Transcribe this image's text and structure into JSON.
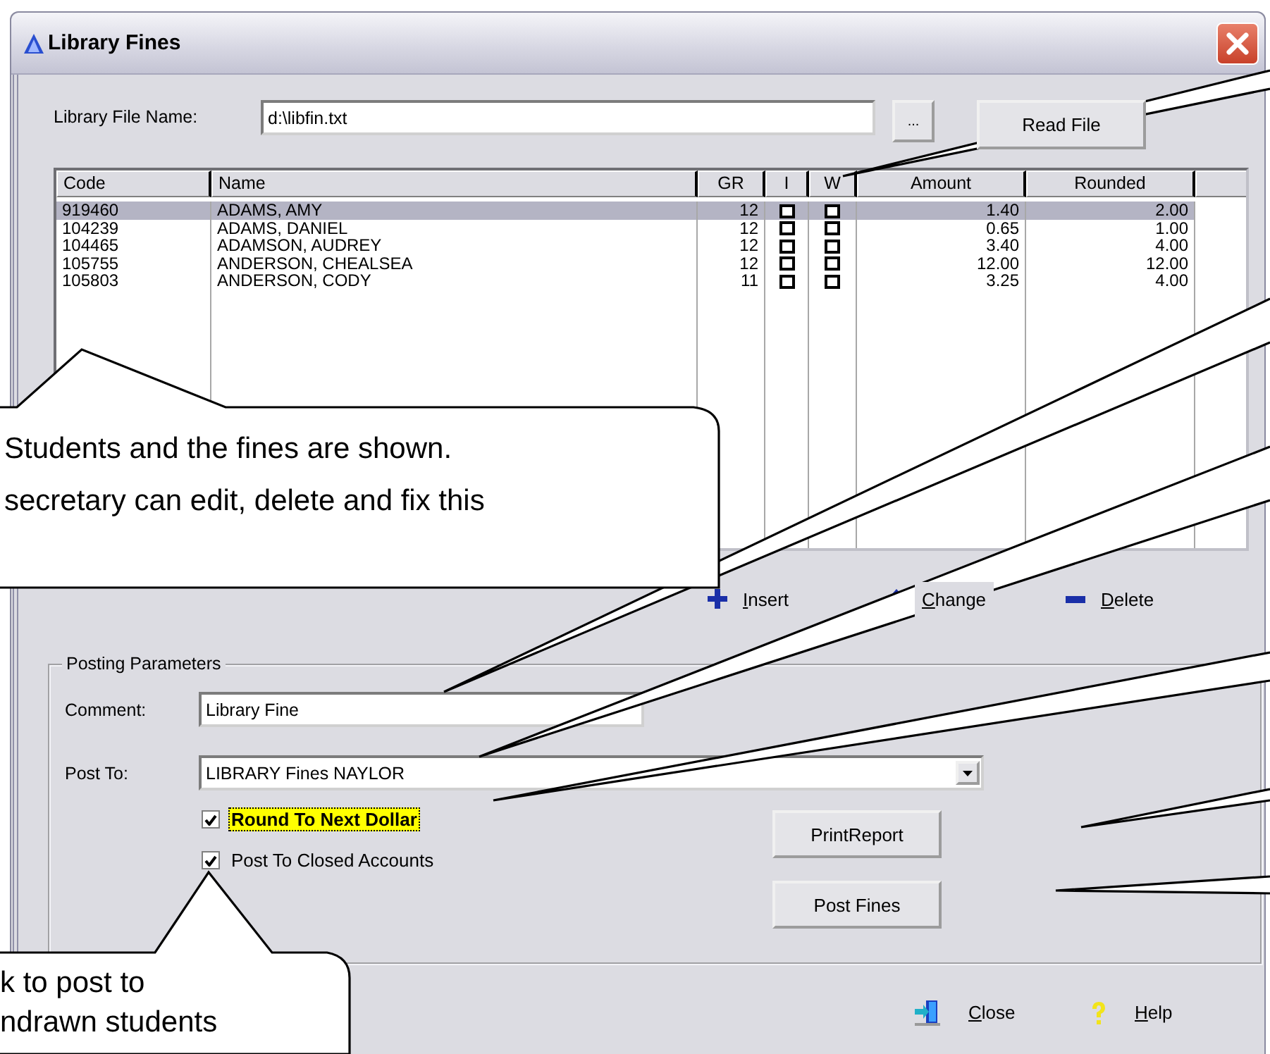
{
  "window": {
    "title": "Library Fines"
  },
  "file": {
    "label": "Library File Name:",
    "value": "d:\\libfin.txt",
    "browse": "...",
    "read_button": "Read File"
  },
  "table": {
    "columns": [
      {
        "label": "Code",
        "kind": "text"
      },
      {
        "label": "Name",
        "kind": "text"
      },
      {
        "label": "GR",
        "kind": "text"
      },
      {
        "label": "I",
        "kind": "check"
      },
      {
        "label": "W",
        "kind": "check"
      },
      {
        "label": "Amount",
        "kind": "text"
      },
      {
        "label": "Rounded",
        "kind": "text"
      }
    ],
    "rows": [
      {
        "selected": true,
        "cells": [
          "919460",
          "ADAMS, AMY",
          "12",
          false,
          false,
          "1.40",
          "2.00"
        ]
      },
      {
        "selected": false,
        "cells": [
          "104239",
          "ADAMS, DANIEL",
          "12",
          false,
          false,
          "0.65",
          "1.00"
        ]
      },
      {
        "selected": false,
        "cells": [
          "104465",
          "ADAMSON, AUDREY",
          "12",
          false,
          false,
          "3.40",
          "4.00"
        ]
      },
      {
        "selected": false,
        "cells": [
          "105755",
          "ANDERSON, CHEALSEA",
          "12",
          false,
          false,
          "12.00",
          "12.00"
        ]
      },
      {
        "selected": false,
        "cells": [
          "105803",
          "ANDERSON, CODY",
          "11",
          false,
          false,
          "3.25",
          "4.00"
        ]
      }
    ]
  },
  "actions": [
    {
      "kind": "insert",
      "label": "Insert"
    },
    {
      "kind": "change",
      "label": "Change"
    },
    {
      "kind": "delete",
      "label": "Delete"
    }
  ],
  "posting": {
    "legend": "Posting Parameters",
    "comment_label": "Comment:",
    "comment": "Library Fine",
    "post_to_label": "Post To:",
    "post_to": "LIBRARY Fines NAYLOR",
    "options": [
      {
        "label": "Round To Next Dollar",
        "checked": true,
        "highlighted": true
      },
      {
        "label": "Post To Closed Accounts",
        "checked": true,
        "highlighted": false
      }
    ],
    "buttons": [
      "PrintReport",
      "Post Fines"
    ]
  },
  "footer": [
    {
      "kind": "close",
      "label": "Close"
    },
    {
      "kind": "help",
      "label": "Help"
    }
  ],
  "callouts": [
    {
      "lines": [
        "Students and the fines are shown.",
        "secretary can edit, delete and fix this"
      ]
    },
    {
      "lines": [
        "k to post to",
        "ndrawn students"
      ]
    }
  ]
}
